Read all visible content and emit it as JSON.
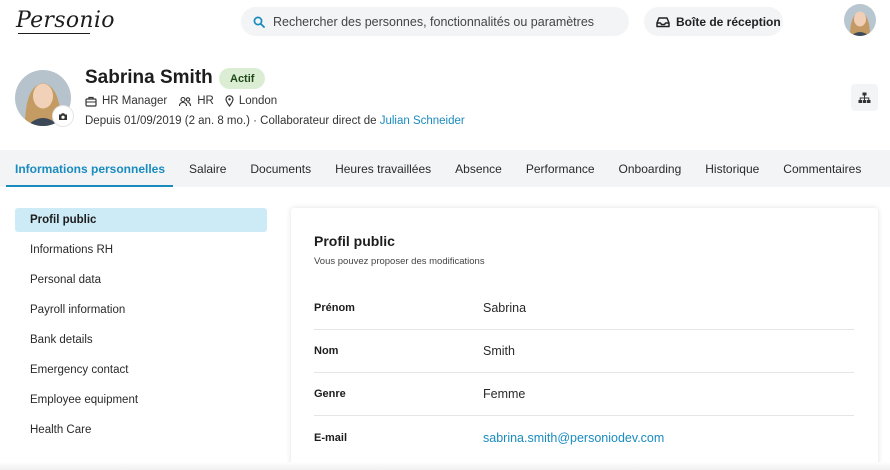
{
  "app": {
    "logo_text": "Personio"
  },
  "search": {
    "placeholder": "Rechercher des personnes, fonctionnalités ou paramètres"
  },
  "inbox": {
    "label": "Boîte de réception"
  },
  "profile": {
    "name": "Sabrina Smith",
    "status": "Actif",
    "position": "HR Manager",
    "department": "HR",
    "office": "London",
    "since_text": "Depuis 01/09/2019 (2 an. 8 mo.) · Collaborateur direct de ",
    "manager": "Julian Schneider"
  },
  "tabs": [
    {
      "label": "Informations personnelles",
      "active": true
    },
    {
      "label": "Salaire"
    },
    {
      "label": "Documents"
    },
    {
      "label": "Heures travaillées"
    },
    {
      "label": "Absence"
    },
    {
      "label": "Performance"
    },
    {
      "label": "Onboarding"
    },
    {
      "label": "Historique"
    },
    {
      "label": "Commentaires"
    }
  ],
  "side_nav": [
    {
      "label": "Profil public",
      "active": true
    },
    {
      "label": "Informations RH"
    },
    {
      "label": "Personal data"
    },
    {
      "label": "Payroll information"
    },
    {
      "label": "Bank details"
    },
    {
      "label": "Emergency contact"
    },
    {
      "label": "Employee equipment"
    },
    {
      "label": "Health Care"
    }
  ],
  "card": {
    "title": "Profil public",
    "subtitle": "Vous pouvez proposer des modifications",
    "fields": [
      {
        "label": "Prénom",
        "value": "Sabrina"
      },
      {
        "label": "Nom",
        "value": "Smith"
      },
      {
        "label": "Genre",
        "value": "Femme"
      },
      {
        "label": "E-mail",
        "value": "sabrina.smith@personiodev.com",
        "link": true
      }
    ]
  },
  "colors": {
    "accent": "#1a8bbf",
    "active_bg": "#cdebf6",
    "badge_bg": "#dbeed4",
    "surface": "#f2f4f6"
  },
  "icons": [
    "search-icon",
    "inbox-icon",
    "briefcase-icon",
    "team-icon",
    "location-pin-icon",
    "camera-icon",
    "org-chart-icon"
  ]
}
